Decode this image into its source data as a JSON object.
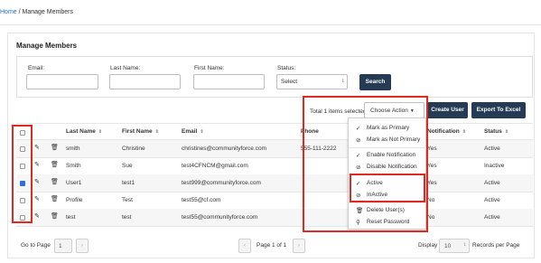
{
  "breadcrumb": {
    "home": "Home",
    "separator": " / ",
    "current": "Manage Members"
  },
  "page_title": "Manage Members",
  "search": {
    "email_label": "Email:",
    "last_name_label": "Last Name:",
    "first_name_label": "First Name:",
    "status_label": "Status:",
    "status_value": "Select",
    "search_button": "Search"
  },
  "toolbar": {
    "total_selected": "Total 1 items selected",
    "choose_action": "Choose Action",
    "create_user": "Create User",
    "export_excel": "Export To Excel"
  },
  "table": {
    "columns": {
      "last_name": "Last Name",
      "first_name": "First Name",
      "email": "Email",
      "phone": "Phone",
      "notification": "Notification",
      "status": "Status"
    },
    "rows": [
      {
        "last": "smith",
        "first": "Christine",
        "email": "christines@communityforce.com",
        "phone": "555-111-2222",
        "notification": "Yes",
        "status": "Active",
        "checked": false
      },
      {
        "last": "Smith",
        "first": "Sue",
        "email": "test4CFNCM@gmail.com",
        "phone": "",
        "notification": "Yes",
        "status": "Inactive",
        "checked": false
      },
      {
        "last": "User1",
        "first": "test1",
        "email": "test999@communityforce.com",
        "phone": "",
        "notification": "Yes",
        "status": "Active",
        "checked": true
      },
      {
        "last": "Profile",
        "first": "Test",
        "email": "test55@cf.com",
        "phone": "",
        "notification": "No",
        "status": "Active",
        "checked": false
      },
      {
        "last": "test",
        "first": "test",
        "email": "test55@communityforce.com",
        "phone": "",
        "notification": "No",
        "status": "Active",
        "checked": false
      }
    ]
  },
  "dropdown": {
    "items": [
      {
        "icon": "check-icon",
        "label": "Mark as Primary"
      },
      {
        "icon": "ban-icon",
        "label": "Mark as Not Primary"
      },
      {
        "icon": "check-icon",
        "label": "Enable Notification"
      },
      {
        "icon": "ban-icon",
        "label": "Disable Notification"
      },
      {
        "icon": "check-icon",
        "label": "Active"
      },
      {
        "icon": "ban-icon",
        "label": "InActive"
      },
      {
        "icon": "trash-icon",
        "label": "Delete User(s)"
      },
      {
        "icon": "key-icon",
        "label": "Reset Password"
      }
    ]
  },
  "pagination": {
    "go_to_page": "Go to Page",
    "page_input": "1",
    "page_of": "Page 1 of 1",
    "display_label": "Display",
    "display_value": "10",
    "records_per_page": "Records per Page"
  },
  "colors": {
    "accent_dark": "#253b55",
    "highlight_red": "#e02a1f",
    "link_blue": "#2a6ebb",
    "checkbox_blue": "#2f6fd6"
  }
}
